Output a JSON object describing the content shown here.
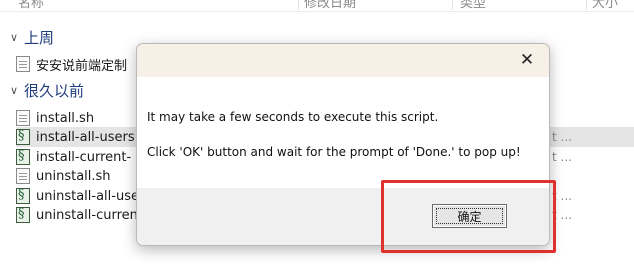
{
  "explorer": {
    "columns": {
      "name": "名称",
      "modified": "修改日期",
      "type": "类型",
      "size": "大小"
    },
    "groups": [
      {
        "label": "上周",
        "files": [
          {
            "name": "安安说前端定制",
            "icon": "document-icon"
          }
        ]
      },
      {
        "label": "很久以前",
        "files": [
          {
            "name": "install.sh",
            "icon": "document-icon"
          },
          {
            "name": "install-all-users",
            "icon": "script-icon",
            "selected": true,
            "trail": "t ..."
          },
          {
            "name": "install-current-",
            "icon": "script-icon",
            "trail": "t ..."
          },
          {
            "name": "uninstall.sh",
            "icon": "document-icon"
          },
          {
            "name": "uninstall-all-use",
            "icon": "script-icon",
            "trail": "t ..."
          },
          {
            "name": "uninstall-curren",
            "icon": "script-icon",
            "trail": "t ..."
          }
        ]
      }
    ]
  },
  "dialog": {
    "close_label": "✕",
    "message_line1": "It may take a few seconds to execute this script.",
    "message_line2": "Click 'OK' button and wait for the prompt of 'Done.' to pop up!",
    "ok_label": "确定",
    "highlight_color": "#e0312d"
  }
}
